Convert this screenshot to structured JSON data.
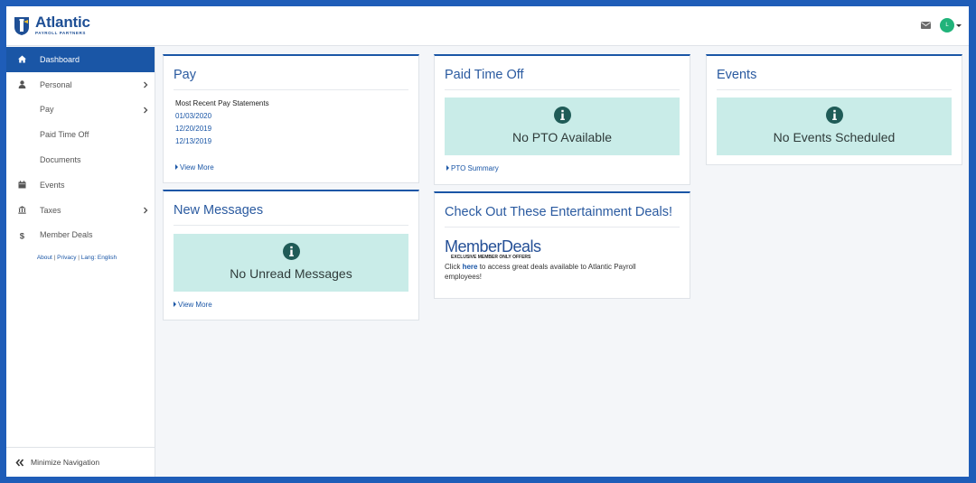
{
  "header": {
    "logo_name": "Atlantic",
    "logo_sub": "PAYROLL PARTNERS",
    "avatar_initial": "L",
    "icons": {
      "mail": "mail-icon",
      "avatar_menu": "chevron-down-icon"
    }
  },
  "sidebar": {
    "items": [
      {
        "label": "Dashboard",
        "icon": "home-icon",
        "active": true
      },
      {
        "label": "Personal",
        "icon": "user-icon",
        "chevron": true
      },
      {
        "label": "Pay",
        "chevron": true
      },
      {
        "label": "Paid Time Off"
      },
      {
        "label": "Documents"
      },
      {
        "label": "Events",
        "icon": "calendar-icon"
      },
      {
        "label": "Taxes",
        "icon": "bank-icon",
        "chevron": true
      },
      {
        "label": "Member Deals",
        "icon": "dollar-icon"
      }
    ],
    "links": {
      "about": "About",
      "privacy": "Privacy",
      "lang": "Lang: English",
      "sep": "|"
    },
    "minimize_label": "Minimize Navigation"
  },
  "pay_card": {
    "title": "Pay",
    "heading": "Most Recent Pay Statements",
    "statements": [
      "01/03/2020",
      "12/20/2019",
      "12/13/2019"
    ],
    "view_more": "View More"
  },
  "pto_card": {
    "title": "Paid Time Off",
    "message": "No PTO Available",
    "summary_link": "PTO Summary"
  },
  "events_card": {
    "title": "Events",
    "message": "No Events Scheduled"
  },
  "messages_card": {
    "title": "New Messages",
    "message": "No Unread Messages",
    "view_more": "View More"
  },
  "deals_card": {
    "title": "Check Out These Entertainment Deals!",
    "logo_name": "MemberDeals",
    "logo_sub": "EXCLUSIVE MEMBER ONLY OFFERS",
    "text_before": "Click ",
    "link": "here",
    "text_after": " to access great deals available to Atlantic Payroll employees!"
  },
  "colors": {
    "frame": "#1f5db8",
    "accent": "#1a56a6",
    "info_bg": "#c9ece8",
    "info_icon": "#1f5b57",
    "avatar": "#21b37a"
  }
}
